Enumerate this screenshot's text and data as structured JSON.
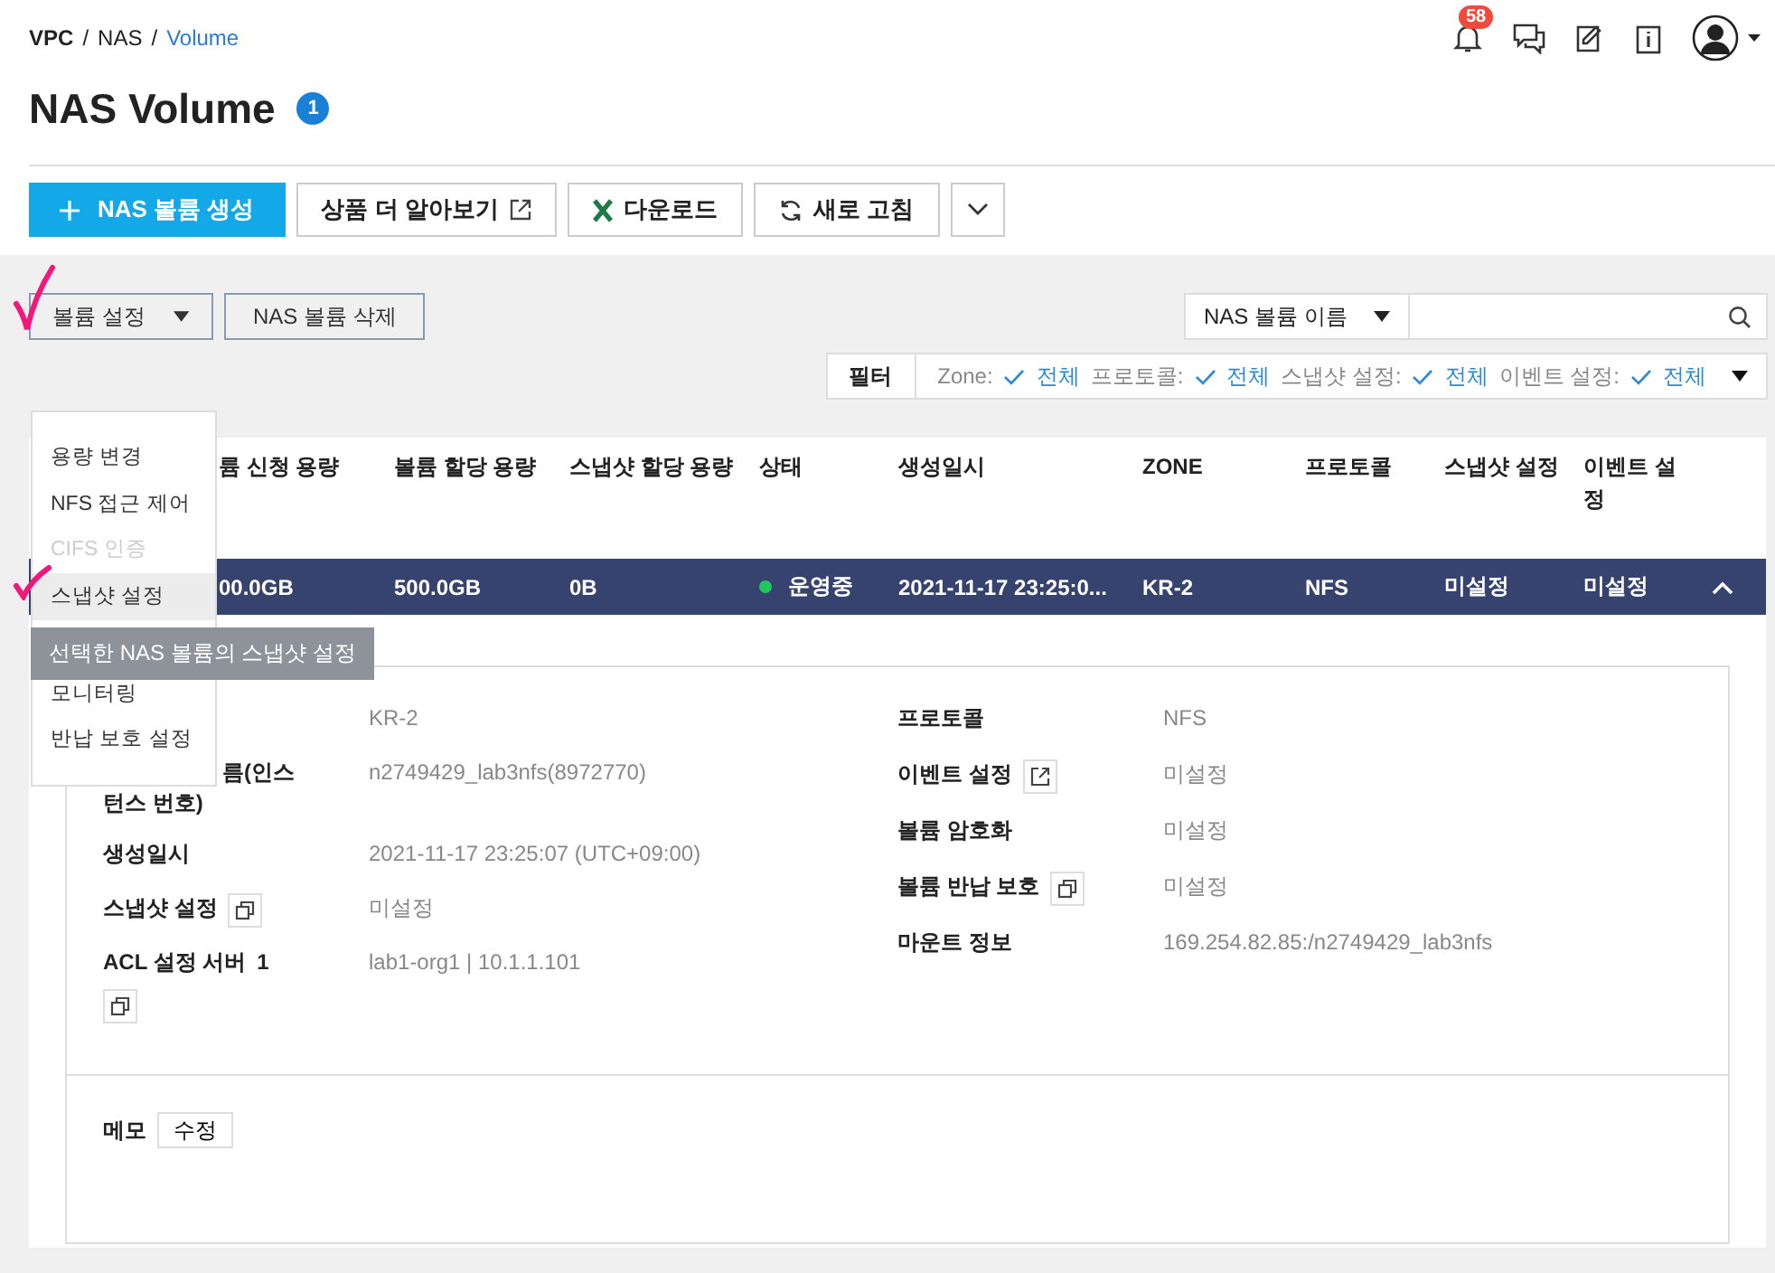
{
  "breadcrumb": [
    {
      "label": "VPC",
      "current": false,
      "separator": "/"
    },
    {
      "label": "NAS",
      "current": false,
      "separator": "/"
    },
    {
      "label": "Volume",
      "current": true
    }
  ],
  "notification_count": "58",
  "title": "NAS Volume",
  "title_count": "1",
  "toolbar_buttons": [
    {
      "kind": "primary",
      "label": "NAS 볼륨 생성"
    },
    {
      "kind": "external",
      "label": "상품 더 알아보기"
    },
    {
      "kind": "excel",
      "label": "다운로드"
    },
    {
      "kind": "refresh",
      "label": "새로 고침"
    },
    {
      "kind": "more"
    }
  ],
  "actions": [
    {
      "kind": "dropdown",
      "label": "볼륨 설정"
    },
    {
      "kind": "button",
      "label": "NAS 볼륨 삭제"
    }
  ],
  "search": {
    "scope": "NAS 볼륨 이름"
  },
  "filter": {
    "label": "필터",
    "items": [
      {
        "name": "Zone:",
        "value": "전체"
      },
      {
        "name": "프로토콜:",
        "value": "전체"
      },
      {
        "name": "스냅샷 설정:",
        "value": "전체"
      },
      {
        "name": "이벤트 설정:",
        "value": "전체"
      }
    ]
  },
  "table": {
    "columns": [
      "륨 신청 용량",
      "볼륨 할당 용량",
      "스냅샷 할당 용량",
      "상태",
      "생성일시",
      "ZONE",
      "프로토콜",
      "스냅샷 설정",
      "이벤트 설정"
    ],
    "rows": [
      {
        "selected": true,
        "expanded": true,
        "cells": [
          "00.0GB",
          "500.0GB",
          "0B",
          "운영중",
          "2021-11-17 23:25:0...",
          "KR-2",
          "NFS",
          "미설정",
          "미설정"
        ]
      }
    ]
  },
  "details": {
    "left": [
      {
        "kind": "text",
        "value": "KR-2"
      },
      {
        "kind": "covered",
        "label": "름(인스턴스 번호)",
        "value": "n2749429_lab3nfs(8972770)"
      },
      {
        "kind": "text",
        "label": "생성일시",
        "value": "2021-11-17 23:25:07 (UTC+09:00)"
      },
      {
        "kind": "copy",
        "label": "스냅샷 설정",
        "value": "미설정"
      },
      {
        "kind": "copy_below",
        "label": "ACL 설정 서버",
        "count": "1",
        "value": "lab1-org1 | 10.1.1.101"
      }
    ],
    "right": [
      {
        "kind": "text",
        "label": "프로토콜",
        "value": "NFS"
      },
      {
        "kind": "link",
        "label": "이벤트 설정",
        "value": "미설정"
      },
      {
        "kind": "text",
        "label": "볼륨 암호화",
        "value": "미설정"
      },
      {
        "kind": "copy",
        "label": "볼륨 반납 보호",
        "value": "미설정"
      },
      {
        "kind": "text",
        "label": "마운트 정보",
        "value": "169.254.82.85:/n2749429_lab3nfs"
      }
    ]
  },
  "memo": {
    "label": "메모",
    "button": "수정"
  },
  "menu": {
    "items": [
      {
        "label": "용량 변경",
        "disabled": false,
        "selected": false
      },
      {
        "label": "NFS 접근 제어",
        "disabled": false,
        "selected": false
      },
      {
        "label": "CIFS 인증",
        "disabled": true,
        "selected": false
      },
      {
        "label": "스냅샷 설정",
        "disabled": false,
        "selected": true
      },
      {
        "label": "모니터링",
        "disabled": false,
        "selected": false
      },
      {
        "label": "반납 보호 설정",
        "disabled": false,
        "selected": false
      }
    ]
  },
  "tooltip": "선택한 NAS 볼륨의 스냅샷 설정"
}
